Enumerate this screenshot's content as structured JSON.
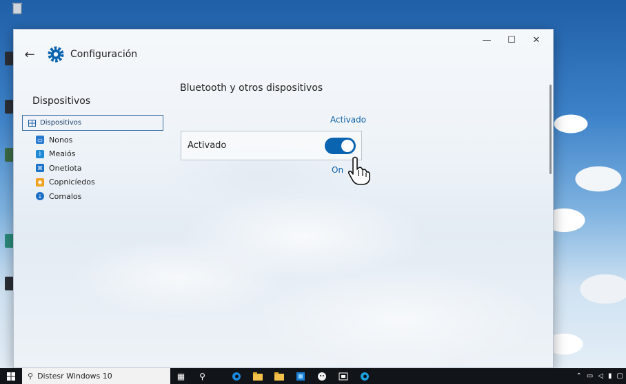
{
  "window": {
    "title": "Configuración",
    "controls": {
      "minimize": "—",
      "maximize": "☐",
      "close": "✕"
    }
  },
  "nav": {
    "title": "Dispositivos",
    "selected": "Dispositivos",
    "items": [
      {
        "label": "Nonos",
        "icon": "display-icon",
        "color": "#2a7bd0"
      },
      {
        "label": "Meaiós",
        "icon": "bluetooth-icon",
        "color": "#1f8ad6"
      },
      {
        "label": "Onetiota",
        "icon": "network-icon",
        "color": "#1c74c8"
      },
      {
        "label": "Copnicíedos",
        "icon": "autoplay-icon",
        "color": "#f0a020"
      },
      {
        "label": "Comalos",
        "icon": "download-icon",
        "color": "#1b6fc4"
      }
    ]
  },
  "main": {
    "section_title": "Bluetooth y otros dispositivos",
    "status_link": "Activado",
    "toggle": {
      "label": "Activado",
      "state": "on",
      "state_label": "On"
    }
  },
  "taskbar": {
    "search_text": "Distesr Windows 10"
  },
  "colors": {
    "accent": "#0a64b0",
    "link": "#0a5fa8"
  }
}
